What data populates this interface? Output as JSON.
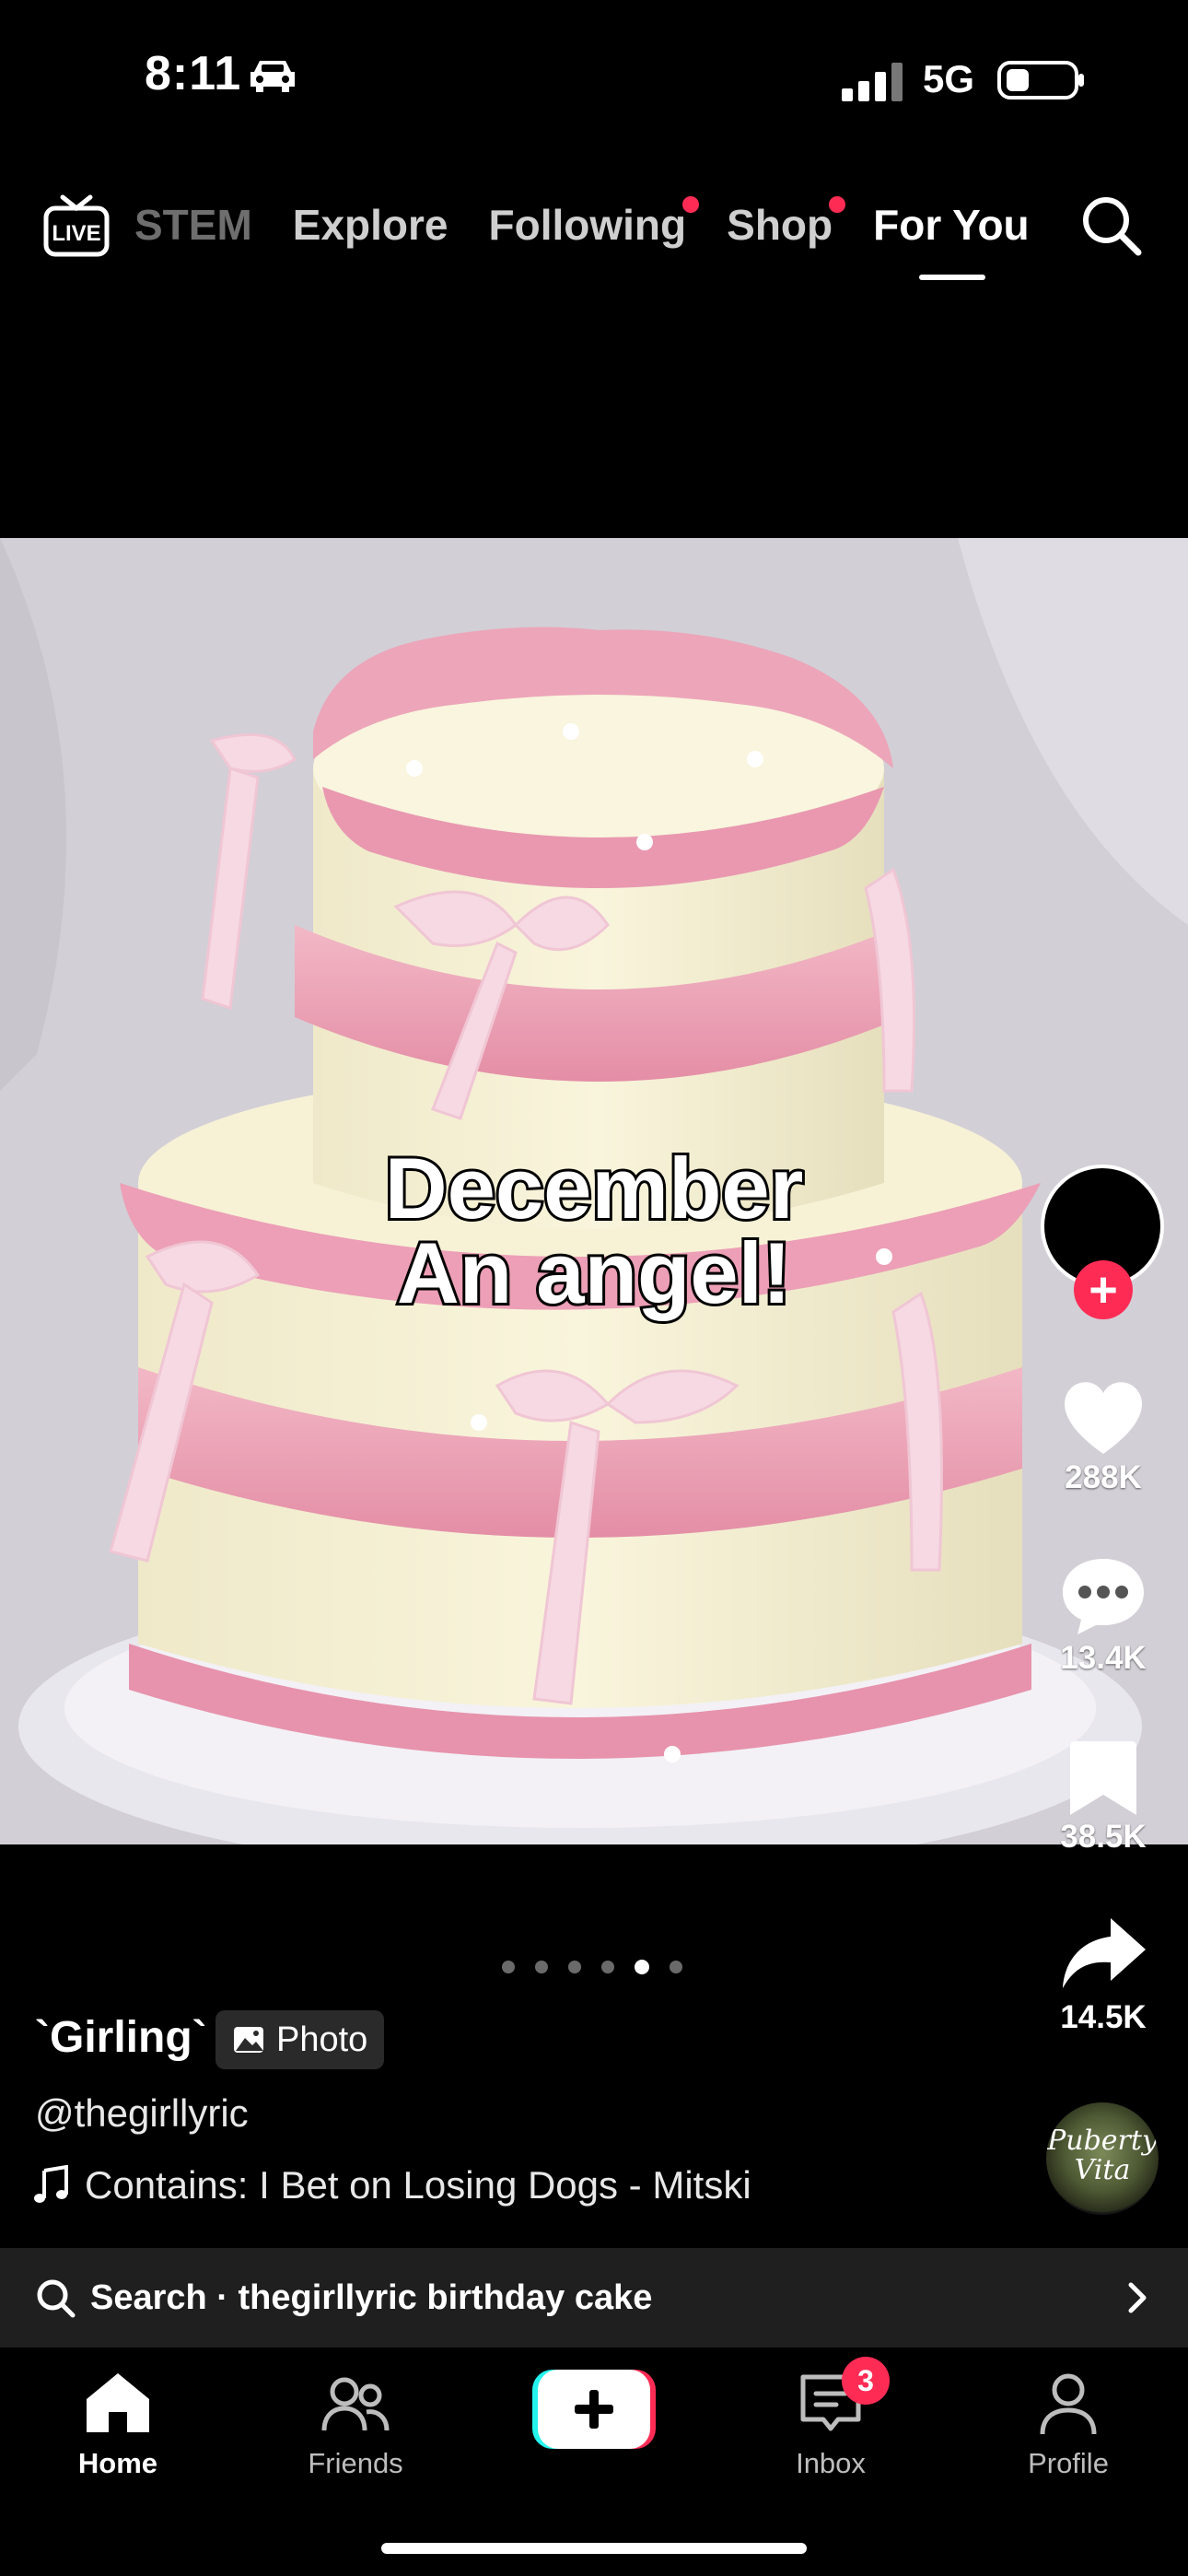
{
  "status_bar": {
    "time": "8:11",
    "network": "5G"
  },
  "top_nav": {
    "tabs": [
      {
        "label": "STEM",
        "faded": true,
        "dot": false
      },
      {
        "label": "Explore",
        "faded": false,
        "dot": false
      },
      {
        "label": "Following",
        "faded": false,
        "dot": true
      },
      {
        "label": "Shop",
        "faded": false,
        "dot": true
      },
      {
        "label": "For You",
        "faded": false,
        "dot": false,
        "active": true
      }
    ],
    "live_icon": "live-tv-icon",
    "search_icon": "search-icon"
  },
  "post": {
    "caption_line1": "December",
    "caption_line2": "An angel!",
    "title": "`Girling`",
    "badge_label": "Photo",
    "username": "@thegirllyric",
    "music": "Contains: I Bet on Losing Dogs - Mitski",
    "music_disc_text": "Puberty Vita",
    "photo_count": 6,
    "current_photo": 5
  },
  "actions": {
    "likes": "288K",
    "comments": "13.4K",
    "saves": "38.5K",
    "shares": "14.5K"
  },
  "search_suggestion": {
    "prefix": "Search",
    "query": "thegirllyric birthday cake",
    "separator": " · "
  },
  "bottom_nav": {
    "items": [
      {
        "label": "Home",
        "icon": "home-icon",
        "active": true
      },
      {
        "label": "Friends",
        "icon": "friends-icon",
        "active": false
      },
      {
        "label": "",
        "icon": "create-plus-icon",
        "active": false
      },
      {
        "label": "Inbox",
        "icon": "inbox-icon",
        "active": false,
        "badge": "3"
      },
      {
        "label": "Profile",
        "icon": "profile-icon",
        "active": false
      }
    ]
  },
  "colors": {
    "accent": "#fe2c55",
    "background": "#000000"
  }
}
